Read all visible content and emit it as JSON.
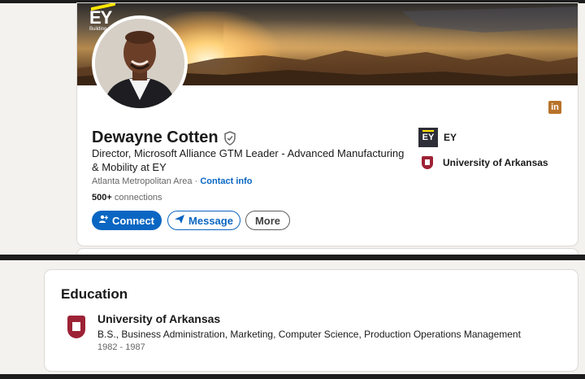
{
  "profile": {
    "name": "Dewayne Cotten",
    "headline": "Director, Microsoft Alliance GTM Leader - Advanced Manufacturing & Mobility at EY",
    "location": "Atlanta Metropolitan Area",
    "location_sep": " · ",
    "contact_info_label": "Contact info",
    "connections_count": "500+",
    "connections_label": "connections"
  },
  "banner": {
    "logo_text": "EY",
    "logo_tagline": "Building a better working world"
  },
  "actions": {
    "connect_label": "Connect",
    "message_label": "Message",
    "more_label": "More"
  },
  "experience_summary": [
    {
      "name": "EY",
      "logo_text": "EY",
      "icon": "ey-logo"
    },
    {
      "name": "University of Arkansas",
      "icon": "university-crest-logo"
    }
  ],
  "education": {
    "title": "Education",
    "items": [
      {
        "school": "University of Arkansas",
        "degree": "B.S., Business Administration, Marketing, Computer Science, Production Operations Management",
        "years": "1982 - 1987",
        "icon": "university-crest-logo"
      }
    ]
  },
  "icons": {
    "linkedin": "linkedin-icon",
    "verified": "verified-shield-icon",
    "connect": "add-person-icon",
    "message": "send-icon"
  },
  "colors": {
    "primary": "#0a66c2",
    "ey_yellow": "#ffe600",
    "ey_dark": "#2e2e38",
    "arkansas_red": "#9d2235",
    "linkedin_badge": "#b8732a"
  }
}
